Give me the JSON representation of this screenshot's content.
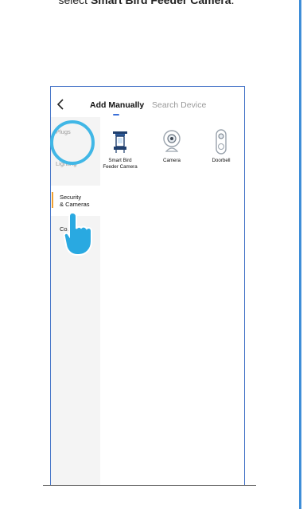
{
  "instruction": {
    "prefix": "select ",
    "bold": "Smart Bird Feeder Camera",
    "suffix": "."
  },
  "header": {
    "back_icon": "chevron-left-icon",
    "tab_manual": "Add Manually",
    "tab_search": "Search Device"
  },
  "sidebar": {
    "items": [
      {
        "label": "Plugs"
      },
      {
        "label": "Lighting"
      },
      {
        "label": "Security\n& Cameras",
        "active": true
      },
      {
        "label": "Co……"
      }
    ]
  },
  "devices": [
    {
      "label": "Smart Bird\nFeeder Camera",
      "icon": "bird-feeder-icon"
    },
    {
      "label": "Camera",
      "icon": "camera-icon"
    },
    {
      "label": "Doorbell",
      "icon": "doorbell-icon"
    }
  ],
  "colors": {
    "accent": "#3a6fd8",
    "active_bar": "#f0a132",
    "highlight": "#41b7e6",
    "sidebar_bg": "#f4f4f4"
  }
}
